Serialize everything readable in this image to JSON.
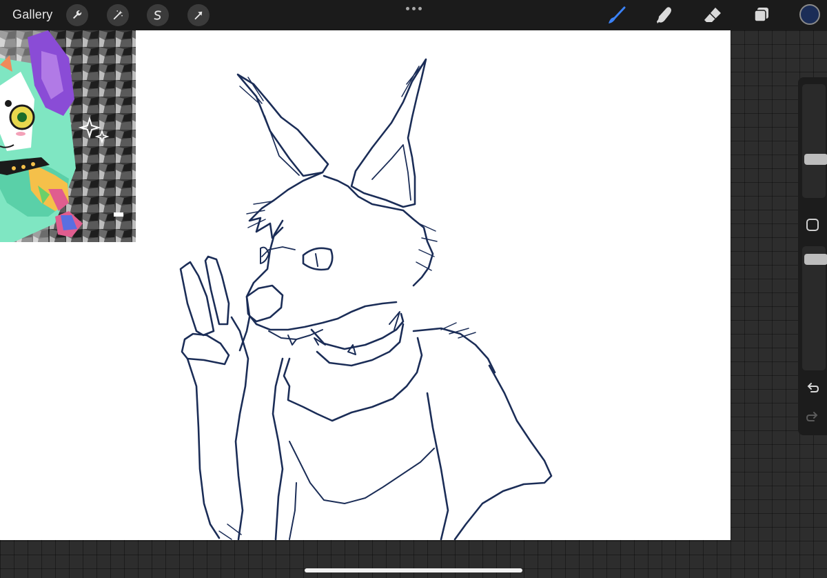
{
  "topbar": {
    "gallery_label": "Gallery",
    "left_tools": [
      {
        "name": "actions",
        "icon": "wrench-icon"
      },
      {
        "name": "adjustments",
        "icon": "magic-wand-icon"
      },
      {
        "name": "selection",
        "icon": "selection-s-icon"
      },
      {
        "name": "transform",
        "icon": "arrow-cursor-icon"
      }
    ],
    "right_tools": [
      {
        "name": "brush",
        "icon": "brush-icon",
        "active_color": "#3b82f6"
      },
      {
        "name": "smudge",
        "icon": "smudge-finger-icon"
      },
      {
        "name": "eraser",
        "icon": "eraser-icon"
      },
      {
        "name": "layers",
        "icon": "layers-icon"
      }
    ],
    "current_color": "#1b2d57"
  },
  "sidebar": {
    "brush_size_level": 0.55,
    "opacity_level": 0.95
  },
  "canvas": {
    "line_color": "#1b2d57",
    "background": "#ffffff"
  }
}
